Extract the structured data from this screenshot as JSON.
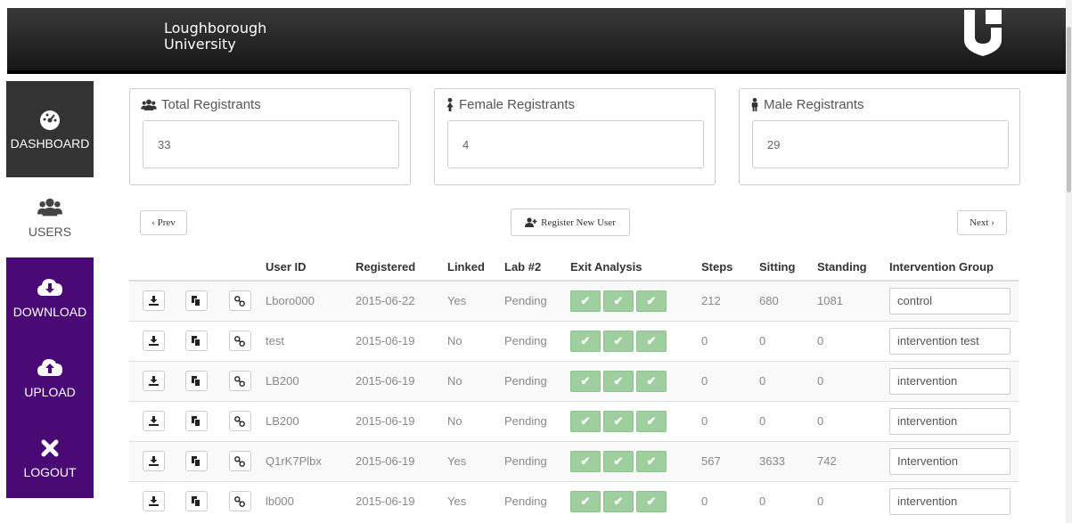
{
  "header": {
    "brand_line1": "Loughborough",
    "brand_line2": "University",
    "logo_icon": "university-shield-logo"
  },
  "nav": [
    {
      "label": "DASHBOARD",
      "icon": "dashboard-gauge-icon"
    },
    {
      "label": "USERS",
      "icon": "users-group-icon"
    },
    {
      "label": "DOWNLOAD",
      "icon": "cloud-download-icon"
    },
    {
      "label": "UPLOAD",
      "icon": "cloud-upload-icon"
    },
    {
      "label": "LOGOUT",
      "icon": "close-x-icon"
    }
  ],
  "stats": {
    "total": {
      "label": "Total Registrants",
      "value": "33"
    },
    "female": {
      "label": "Female Registrants",
      "value": "4"
    },
    "male": {
      "label": "Male Registrants",
      "value": "29"
    }
  },
  "controls": {
    "prev": "‹ Prev",
    "register": "Register New User",
    "next": "Next ›"
  },
  "table": {
    "headers": [
      "User ID",
      "Registered",
      "Linked",
      "Lab #2",
      "Exit Analysis",
      "Steps",
      "Sitting",
      "Standing",
      "Intervention Group"
    ],
    "rows": [
      {
        "user_id": "Lboro000",
        "registered": "2015-06-22",
        "linked": "Yes",
        "lab2": "Pending",
        "steps": "212",
        "sitting": "680",
        "standing": "1081",
        "group": "control"
      },
      {
        "user_id": "test",
        "registered": "2015-06-19",
        "linked": "No",
        "lab2": "Pending",
        "steps": "0",
        "sitting": "0",
        "standing": "0",
        "group": "intervention test"
      },
      {
        "user_id": "LB200",
        "registered": "2015-06-19",
        "linked": "No",
        "lab2": "Pending",
        "steps": "0",
        "sitting": "0",
        "standing": "0",
        "group": "intervention"
      },
      {
        "user_id": "LB200",
        "registered": "2015-06-19",
        "linked": "No",
        "lab2": "Pending",
        "steps": "0",
        "sitting": "0",
        "standing": "0",
        "group": "intervention"
      },
      {
        "user_id": "Q1rK7Plbx",
        "registered": "2015-06-19",
        "linked": "Yes",
        "lab2": "Pending",
        "steps": "567",
        "sitting": "3633",
        "standing": "742",
        "group": "Intervention"
      },
      {
        "user_id": "lb000",
        "registered": "2015-06-19",
        "linked": "Yes",
        "lab2": "Pending",
        "steps": "0",
        "sitting": "0",
        "standing": "0",
        "group": "intervention"
      }
    ]
  },
  "colors": {
    "accent_purple": "#4a0a75",
    "check_green": "#9fcf9f",
    "topbar": "#222222"
  }
}
